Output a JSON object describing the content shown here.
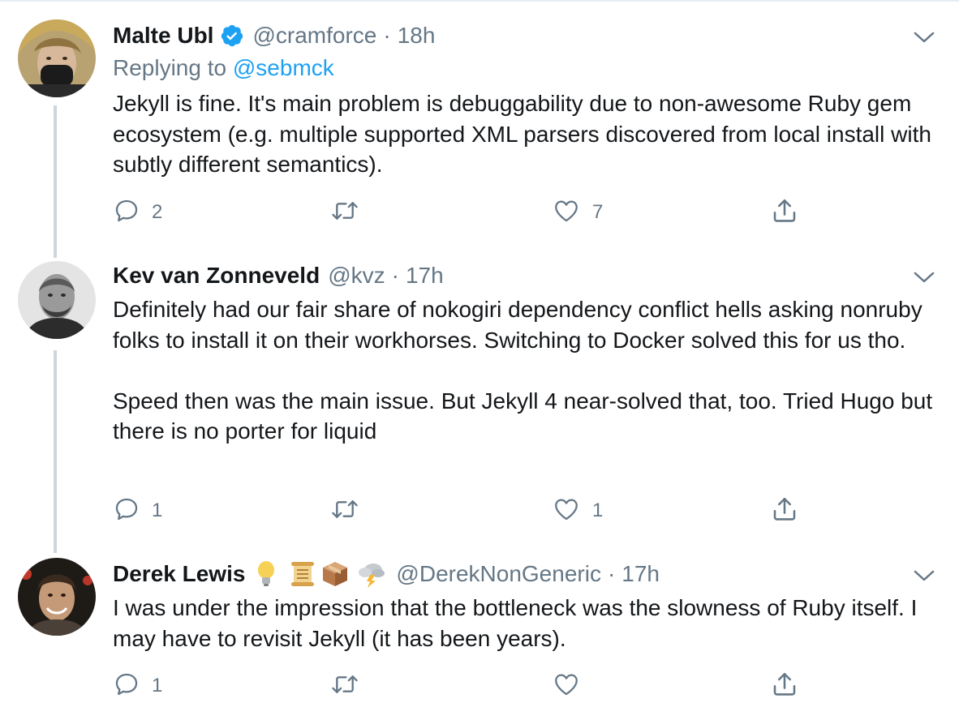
{
  "tweets": [
    {
      "name": "Malte Ubl",
      "verified": true,
      "handle": "@cramforce",
      "separator": "·",
      "time": "18h",
      "replying_prefix": "Replying to ",
      "replying_handle": "@sebmck",
      "paragraphs": [
        "Jekyll is fine. It's main problem is debuggability due to non-awesome Ruby gem ecosystem (e.g. multiple supported XML parsers discovered from local install with subtly different semantics)."
      ],
      "reply_count": "2",
      "retweet_count": "",
      "like_count": "7"
    },
    {
      "name": "Kev van Zonneveld",
      "verified": false,
      "handle": "@kvz",
      "separator": "·",
      "time": "17h",
      "paragraphs": [
        "Definitely had our fair share of nokogiri dependency conflict hells asking nonruby folks to install it on their workhorses. Switching to Docker solved this for us tho.",
        "Speed then was the main issue. But Jekyll 4 near-solved that, too. Tried Hugo but there is no porter for liquid"
      ],
      "reply_count": "1",
      "retweet_count": "",
      "like_count": "1"
    },
    {
      "name": "Derek Lewis",
      "verified": false,
      "name_emojis": [
        "light-bulb",
        "scroll",
        "package",
        "cloud-lightning"
      ],
      "handle": "@DerekNonGeneric",
      "separator": "·",
      "time": "17h",
      "paragraphs": [
        "I was under the impression that the bottleneck was the slowness of Ruby itself. I may have to revisit Jekyll (it has been years)."
      ],
      "reply_count": "1",
      "retweet_count": "",
      "like_count": ""
    }
  ],
  "colors": {
    "text": "#14171a",
    "secondary": "#657786",
    "link": "#1da1f2",
    "verified": "#1da1f2",
    "divider": "#e6ecf0",
    "thread_line": "#ccd6dd"
  }
}
